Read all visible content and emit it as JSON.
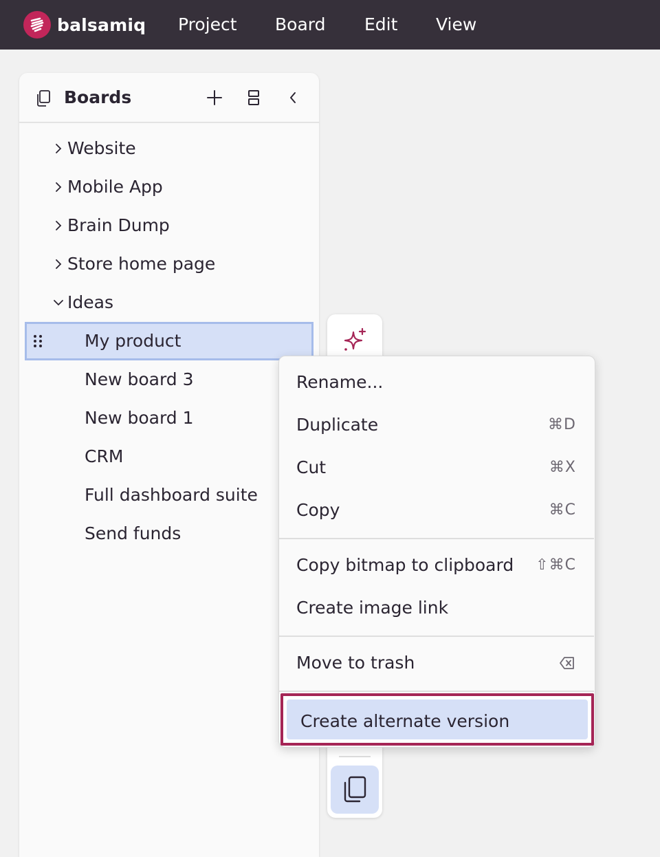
{
  "app": {
    "name": "balsamiq",
    "brand_color": "#c2265a",
    "menu": [
      "Project",
      "Board",
      "Edit",
      "View"
    ]
  },
  "sidebar": {
    "title": "Boards",
    "header_icons": [
      "boards-icon",
      "plus-icon",
      "split-view-icon",
      "chevron-left-icon"
    ],
    "items": [
      {
        "label": "Website",
        "expanded": false
      },
      {
        "label": "Mobile App",
        "expanded": false
      },
      {
        "label": "Brain Dump",
        "expanded": false
      },
      {
        "label": "Store home page",
        "expanded": false
      },
      {
        "label": "Ideas",
        "expanded": true
      }
    ],
    "children": [
      {
        "label": "My product",
        "selected": true
      },
      {
        "label": "New board 3"
      },
      {
        "label": "New board 1"
      },
      {
        "label": "CRM"
      },
      {
        "label": "Full dashboard suite"
      },
      {
        "label": "Send funds"
      }
    ]
  },
  "toolbar": {
    "icons": [
      "sparkle-ai-icon",
      "copy-pages-icon"
    ],
    "ai_color": "#a52556"
  },
  "context_menu": {
    "groups": [
      [
        {
          "label": "Rename...",
          "shortcut": ""
        },
        {
          "label": "Duplicate",
          "shortcut": "⌘D"
        },
        {
          "label": "Cut",
          "shortcut": "⌘X"
        },
        {
          "label": "Copy",
          "shortcut": "⌘C"
        }
      ],
      [
        {
          "label": "Copy bitmap to clipboard",
          "shortcut": "⇧⌘C"
        },
        {
          "label": "Create image link",
          "shortcut": ""
        }
      ],
      [
        {
          "label": "Move to trash",
          "shortcut_icon": "delete-backspace-icon"
        }
      ],
      [
        {
          "label": "Create alternate version",
          "highlighted": true
        }
      ]
    ],
    "highlight_color": "#a52556",
    "selection_color": "#d6e0f7"
  }
}
